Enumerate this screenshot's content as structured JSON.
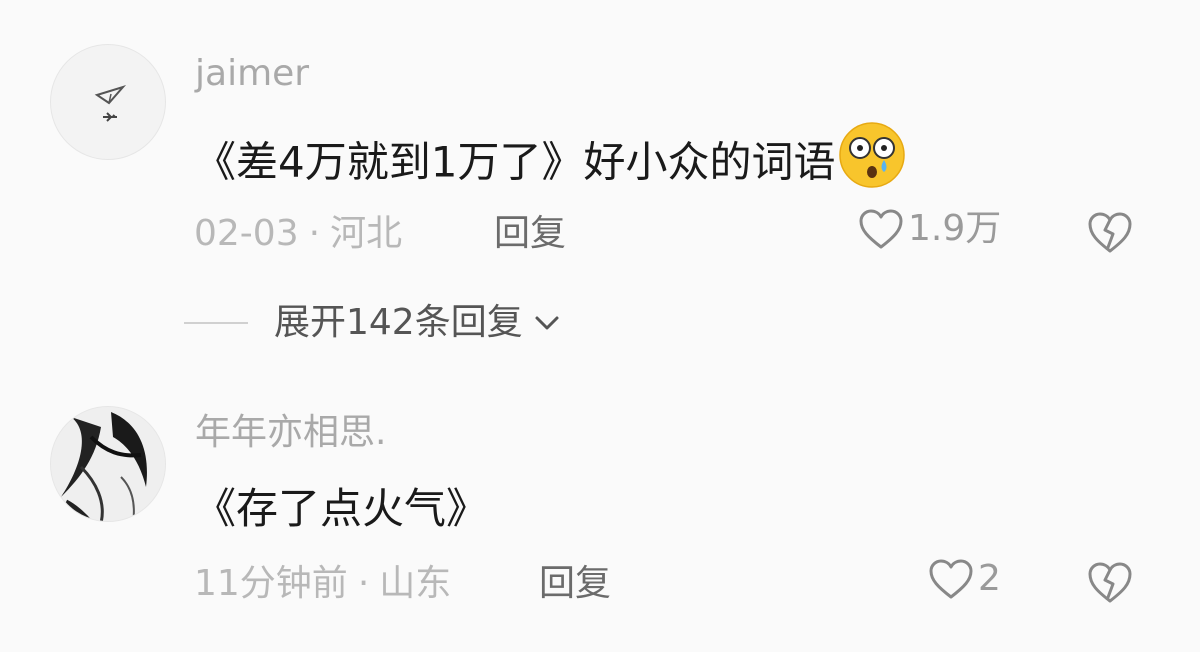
{
  "comments": [
    {
      "username": "jaimer",
      "content": "《差4万就到1万了》好小众的词语",
      "date": "02-03",
      "location": "河北",
      "reply_label": "回复",
      "likes": "1.9万",
      "emoji_icon": "astonished-tear-emoji-icon"
    },
    {
      "username": "年年亦相思.",
      "content": "《存了点火气》",
      "date": "11分钟前",
      "location": "山东",
      "reply_label": "回复",
      "likes": "2"
    }
  ],
  "expand_replies": {
    "label": "展开142条回复"
  },
  "separator": "·",
  "colors": {
    "meta": "#b8b8b8",
    "text": "#1a1a1a",
    "username": "#a9a9a9"
  }
}
